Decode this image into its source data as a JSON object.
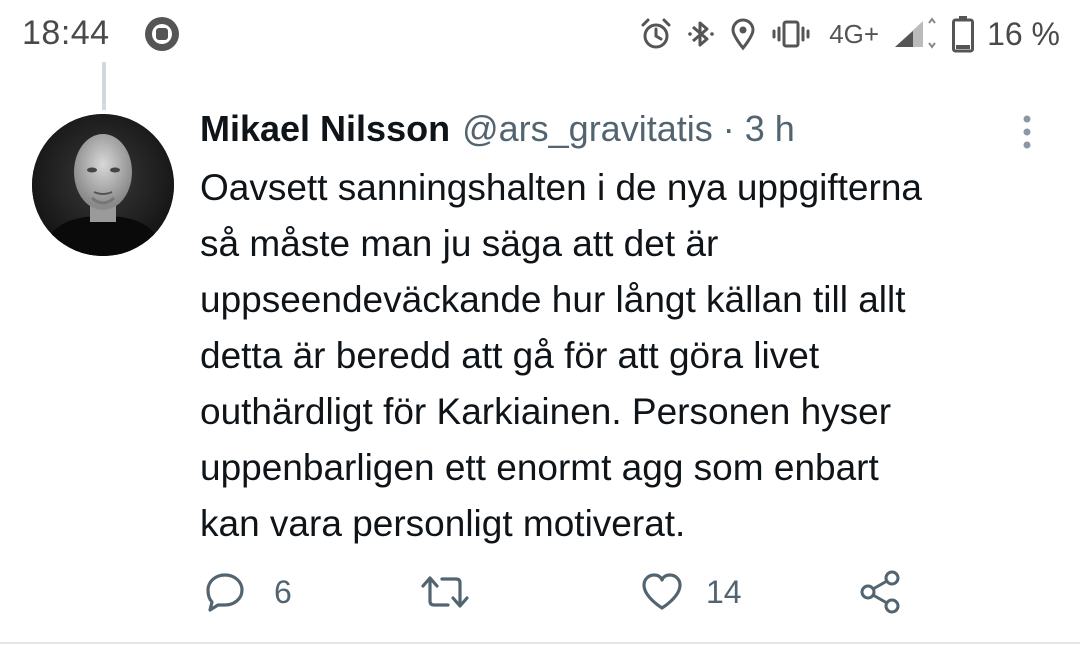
{
  "status_bar": {
    "time": "18:44",
    "network": "4G+",
    "battery_percent": "16 %",
    "icons": [
      "app-notification-icon",
      "alarm-icon",
      "bluetooth-icon",
      "location-icon",
      "vibrate-icon",
      "signal-icon",
      "battery-icon"
    ]
  },
  "tweet": {
    "author_name": "Mikael Nilsson",
    "handle": "@ars_gravitatis",
    "separator": "·",
    "time_ago": "3 h",
    "text_lines": [
      "Oavsett sanningshalten i de nya uppgifterna",
      "så måste man ju säga att det är",
      "uppseendeväckande hur långt källan till allt",
      "detta är beredd att gå för att göra livet",
      "outhärdligt för Karkiainen. Personen hyser",
      "uppenbarligen ett enormt agg som enbart",
      "kan vara personligt motiverat."
    ],
    "actions": {
      "reply_count": "6",
      "retweet_count": "",
      "like_count": "14"
    }
  },
  "colors": {
    "text_primary": "#0f1419",
    "text_secondary": "#536471",
    "thread_line": "#cfd9de"
  }
}
